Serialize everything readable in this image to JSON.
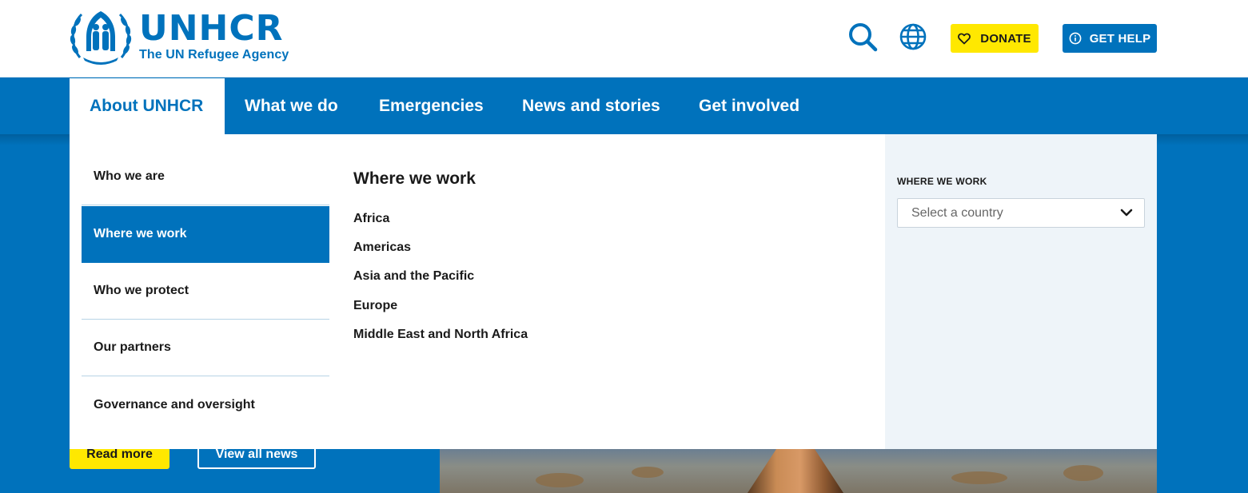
{
  "header": {
    "logo_name": "UNHCR",
    "logo_tagline": "The UN Refugee Agency",
    "donate_label": "DONATE",
    "help_label": "GET HELP",
    "icons": {
      "search": "search-icon",
      "language": "globe-icon",
      "donate": "heart-icon",
      "help": "info-icon",
      "logo": "unhcr-emblem-icon"
    }
  },
  "nav": {
    "items": [
      {
        "label": "About UNHCR",
        "active": true
      },
      {
        "label": "What we do",
        "active": false
      },
      {
        "label": "Emergencies",
        "active": false
      },
      {
        "label": "News and stories",
        "active": false
      },
      {
        "label": "Get involved",
        "active": false
      }
    ]
  },
  "mega_menu": {
    "submenu": [
      {
        "label": "Who we are",
        "active": false
      },
      {
        "label": "Where we work",
        "active": true
      },
      {
        "label": "Who we protect",
        "active": false
      },
      {
        "label": "Our partners",
        "active": false
      },
      {
        "label": "Governance and oversight",
        "active": false
      }
    ],
    "section_title": "Where we work",
    "regions": [
      "Africa",
      "Americas",
      "Asia and the Pacific",
      "Europe",
      "Middle East and North Africa"
    ],
    "side": {
      "label": "WHERE WE WORK",
      "select_placeholder": "Select a country",
      "select_icon": "chevron-down-icon"
    }
  },
  "hero": {
    "read_more_label": "Read more",
    "view_all_label": "View all news"
  },
  "colors": {
    "brand_blue": "#0072bc",
    "donate_yellow": "#ffe800",
    "side_panel": "#eef4f9"
  }
}
